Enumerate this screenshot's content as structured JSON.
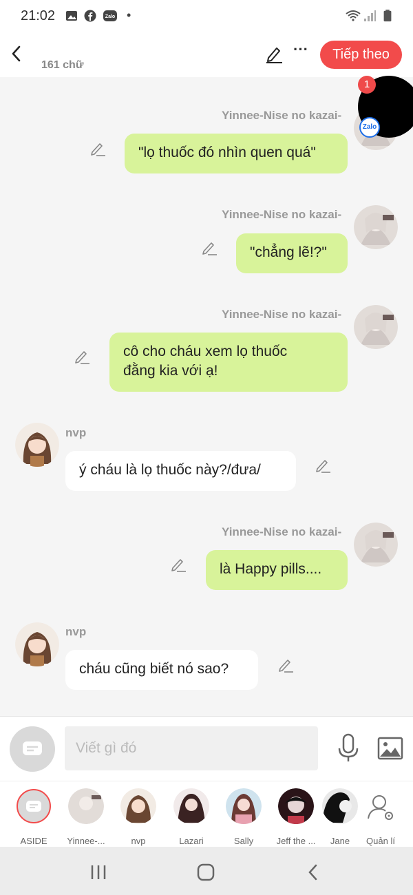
{
  "status_bar": {
    "time": "21:02",
    "icons": [
      "gallery-icon",
      "facebook-icon",
      "zalo-icon",
      "wifi-icon",
      "signal-icon",
      "battery-icon"
    ]
  },
  "header": {
    "word_count": "161 chữ",
    "next_label": "Tiếp theo",
    "more_label": "···",
    "accent_color": "#f24b4b"
  },
  "floating_bubble": {
    "badge_count": "1",
    "app_label": "Zalo"
  },
  "messages": [
    {
      "sender": "Yinnee-Nise no kazai-",
      "text": "\"lọ thuốc đó nhìn quen quá\"",
      "side": "right"
    },
    {
      "sender": "Yinnee-Nise no kazai-",
      "text": "\"chẳng lẽ!?\"",
      "side": "right"
    },
    {
      "sender": "Yinnee-Nise no kazai-",
      "text_line1": "cô cho cháu xem lọ thuốc",
      "text_line2": "đằng kia với ạ!",
      "side": "right"
    },
    {
      "sender": "nvp",
      "text": "ý cháu là lọ thuốc này?/đưa/",
      "side": "left"
    },
    {
      "sender": "Yinnee-Nise no kazai-",
      "text": "là Happy pills....",
      "side": "right"
    },
    {
      "sender": "nvp",
      "text": "cháu cũng biết nó sao?",
      "side": "left"
    }
  ],
  "input": {
    "placeholder": "Viết gì đó"
  },
  "characters": [
    {
      "label": "ASIDE"
    },
    {
      "label": "Yinnee-..."
    },
    {
      "label": "nvp"
    },
    {
      "label": "Lazari"
    },
    {
      "label": "Sally"
    },
    {
      "label": "Jeff the ..."
    },
    {
      "label": "Jane"
    },
    {
      "label": "Quản lí"
    }
  ],
  "colors": {
    "my_bubble": "#d8f39a",
    "their_bubble": "#ffffff",
    "accent": "#f24b4b"
  }
}
